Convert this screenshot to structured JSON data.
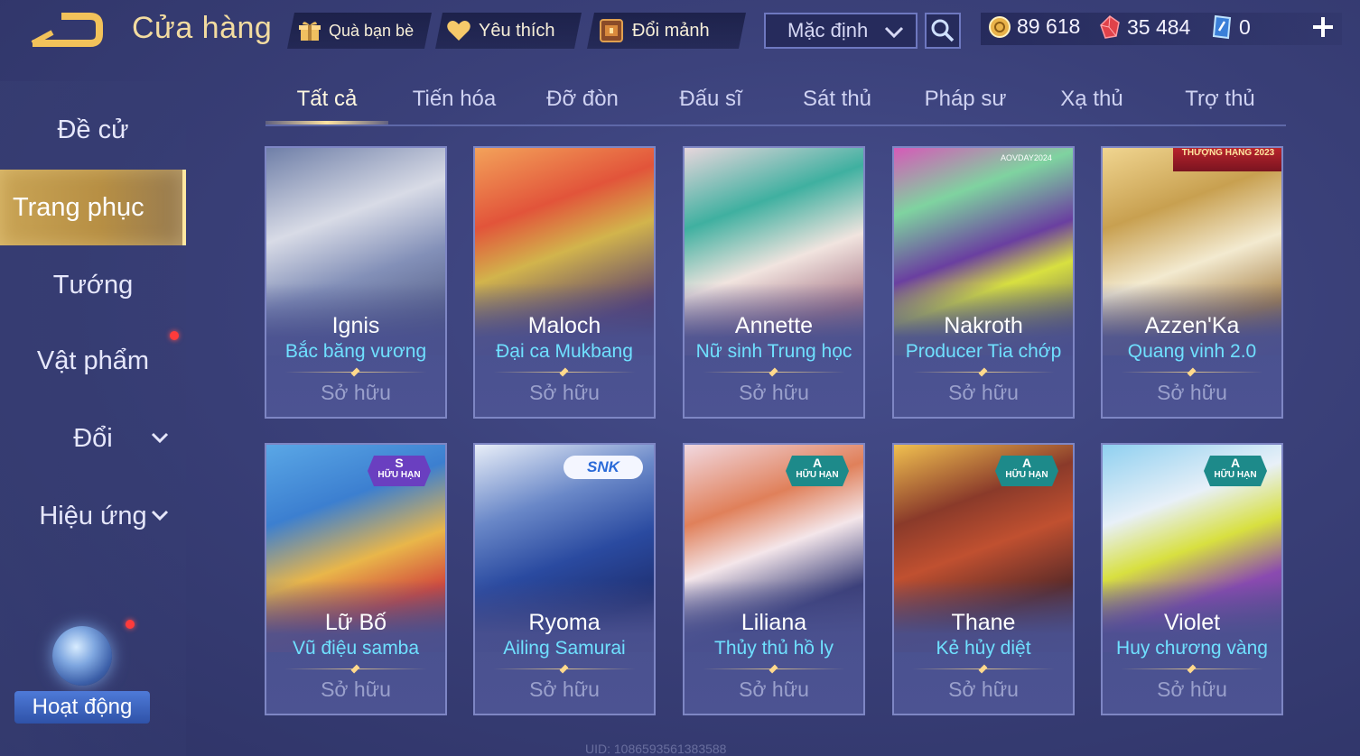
{
  "header": {
    "title": "Cửa hàng",
    "friend_gift": "Quà bạn bè",
    "favorites": "Yêu thích",
    "exchange_shards": "Đổi mảnh",
    "sort_value": "Mặc định",
    "gold": "89 618",
    "gems": "35 484",
    "vouchers": "0"
  },
  "tabs": [
    "Tất cả",
    "Tiến hóa",
    "Đỡ đòn",
    "Đấu sĩ",
    "Sát thủ",
    "Pháp sư",
    "Xạ thủ",
    "Trợ thủ"
  ],
  "sidebar": {
    "items": [
      "Đề cử",
      "Trang phục",
      "Tướng",
      "Vật phẩm",
      "Đổi",
      "Hiệu ứng"
    ],
    "activity": "Hoạt động"
  },
  "cards": [
    {
      "hero": "Ignis",
      "skin": "Bắc băng vương",
      "status": "Sở hữu",
      "badge_text": ""
    },
    {
      "hero": "Maloch",
      "skin": "Đại ca Mukbang",
      "status": "Sở hữu",
      "badge_text": ""
    },
    {
      "hero": "Annette",
      "skin": "Nữ sinh Trung học",
      "status": "Sở hữu",
      "badge_text": ""
    },
    {
      "hero": "Nakroth",
      "skin": "Producer Tia chớp",
      "status": "Sở hữu",
      "badge_text": "AOVDAY2024"
    },
    {
      "hero": "Azzen'Ka",
      "skin": "Quang vinh 2.0",
      "status": "Sở hữu",
      "badge_text": "THƯỢNG HẠNG 2023"
    },
    {
      "hero": "Lữ Bố",
      "skin": "Vũ điệu samba",
      "status": "Sở hữu",
      "badge_tier": "S",
      "badge_text": "HỮU HẠN"
    },
    {
      "hero": "Ryoma",
      "skin": "Ailing Samurai",
      "status": "Sở hữu",
      "badge_text": "SNK"
    },
    {
      "hero": "Liliana",
      "skin": "Thủy thủ hồ ly",
      "status": "Sở hữu",
      "badge_tier": "A",
      "badge_text": "HỮU HẠN"
    },
    {
      "hero": "Thane",
      "skin": "Kẻ hủy diệt",
      "status": "Sở hữu",
      "badge_tier": "A",
      "badge_text": "HỮU HẠN"
    },
    {
      "hero": "Violet",
      "skin": "Huy chương vàng",
      "status": "Sở hữu",
      "badge_tier": "A",
      "badge_text": "HỮU HẠN"
    }
  ],
  "footer": {
    "uid": "UID: 1086593561383588"
  },
  "colors": {
    "accent_gold": "#c9a455",
    "skin_name": "#6fe0ff",
    "badge_s": "#6a3fc0",
    "badge_a": "#1d8a8a"
  }
}
